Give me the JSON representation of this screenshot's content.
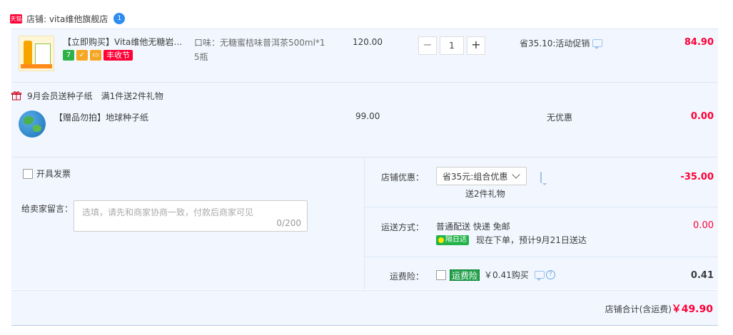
{
  "shop": {
    "badge": "天猫",
    "name": "店铺: vita维他旗舰店",
    "ww_count": "1"
  },
  "item1": {
    "title": "【立即购买】Vita维他无糖岩香...",
    "tags": {
      "seven": "7",
      "promo": "丰收节"
    },
    "sku": "口味：无糖蜜桔味普洱茶500ml*15瓶",
    "price": "120.00",
    "quantity": "1",
    "qty_minus": "−",
    "qty_plus": "+",
    "discount": "省35.10:活动促销",
    "amount": "84.90"
  },
  "gift_section": {
    "header": "9月会员送种子纸　满1件送2件礼物"
  },
  "item2": {
    "title": "【赠品勿拍】地球种子纸",
    "price": "99.00",
    "discount": "无优惠",
    "amount": "0.00"
  },
  "invoice": {
    "label": "开具发票"
  },
  "message": {
    "label": "给卖家留言：",
    "placeholder": "选填，请先和商家协商一致，付款后商家可见",
    "count": "0/200"
  },
  "store_discount": {
    "label": "店铺优惠：",
    "selected": "省35元:组合优惠",
    "note": "送2件礼物",
    "amount": "-35.00"
  },
  "shipping": {
    "label": "运送方式：",
    "method": "普通配送 快递 免邮",
    "badge": "隔日达",
    "eta": "现在下单，预计9月21日送达",
    "amount": "0.00"
  },
  "insurance": {
    "label": "运费险：",
    "tag": "运费险",
    "price_text": "￥0.41购买",
    "help": "?",
    "amount": "0.41"
  },
  "total": {
    "label": "店铺合计(含运费)",
    "value": "￥49.90"
  },
  "colors": {
    "accent_red": "#ff0036",
    "panel_bg": "#f2f7ff",
    "green_badge": "#24b34b"
  }
}
